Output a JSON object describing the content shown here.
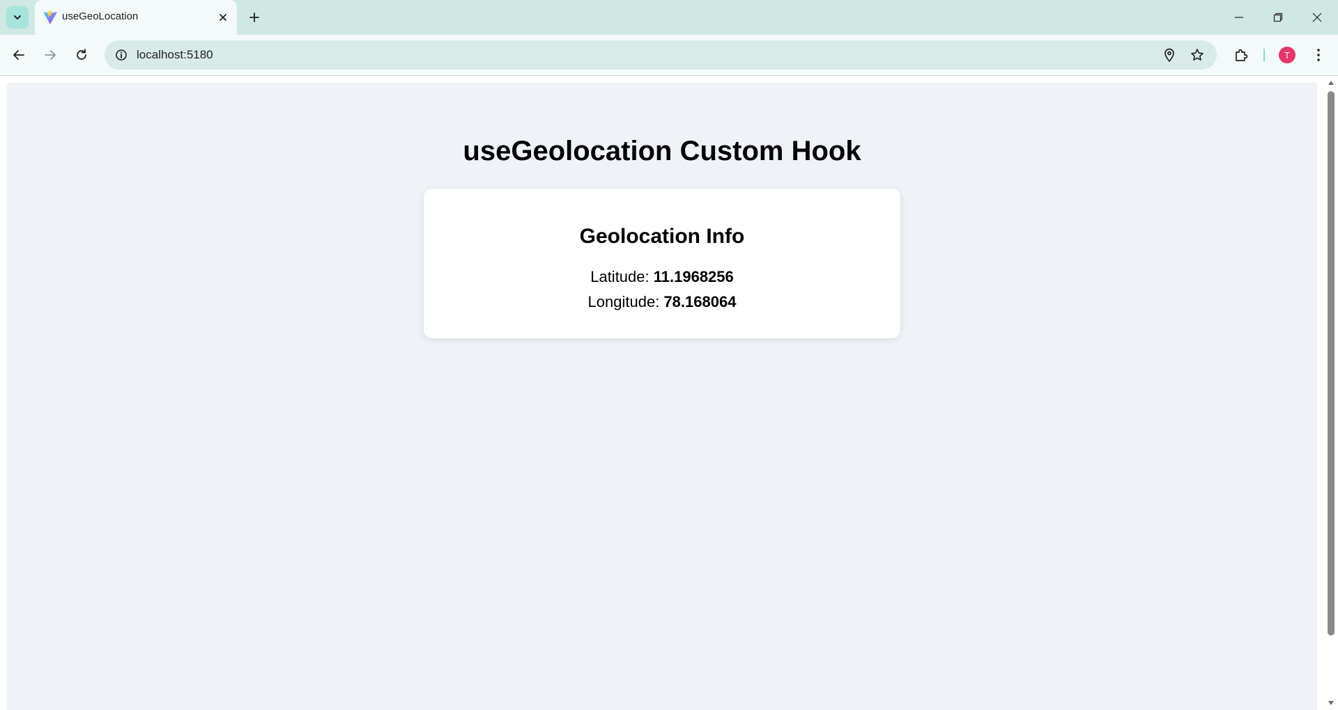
{
  "browser": {
    "tab": {
      "title": "useGeoLocation",
      "favicon": "vite-logo-icon"
    },
    "address_bar": {
      "url": "localhost:5180"
    },
    "profile_initial": "T",
    "colors": {
      "frame": "#cfe8e4",
      "toolbar": "#f4faf9",
      "omnibox": "#d8ebe8",
      "avatar": "#e8336b"
    },
    "icons": [
      "tab-search-icon",
      "close-icon",
      "plus-icon",
      "minimize-icon",
      "restore-icon",
      "back-icon",
      "forward-icon",
      "reload-icon",
      "site-info-icon",
      "location-icon",
      "star-icon",
      "extensions-icon",
      "more-menu-icon"
    ]
  },
  "page": {
    "background": "#eff3f8",
    "title": "useGeolocation Custom Hook",
    "card": {
      "title": "Geolocation Info",
      "latitude_label": "Latitude:",
      "latitude_value": "11.1968256",
      "longitude_label": "Longitude:",
      "longitude_value": "78.168064"
    }
  }
}
